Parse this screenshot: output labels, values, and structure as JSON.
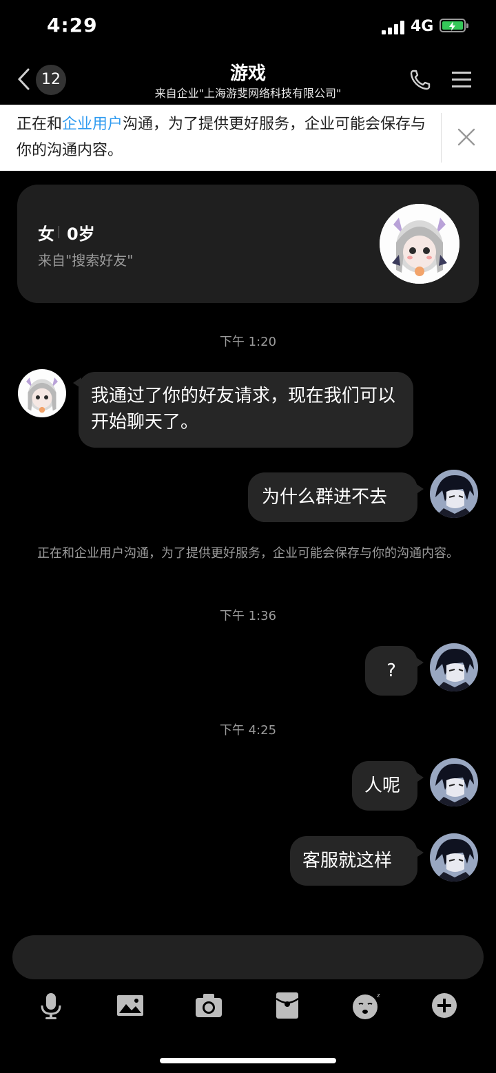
{
  "status_bar": {
    "time": "4:29",
    "network": "4G"
  },
  "nav": {
    "unread_count": "12",
    "title": "游戏",
    "subtitle": "来自企业\"上海游斐网络科技有限公司\""
  },
  "notice": {
    "prefix": "正在和",
    "link": "企业用户",
    "suffix": "沟通，为了提供更好服务，企业可能会保存与你的沟通内容。"
  },
  "profile": {
    "gender": "女",
    "age": "0岁",
    "source": "来自\"搜索好友\""
  },
  "chat": {
    "timestamps": [
      "下午 1:20",
      "下午 1:36",
      "下午 4:25"
    ],
    "system_message": "正在和企业用户沟通，为了提供更好服务，企业可能会保存与你的沟通内容。",
    "messages": [
      {
        "sender": "other",
        "text": "我通过了你的好友请求，现在我们可以开始聊天了。"
      },
      {
        "sender": "me",
        "text": "为什么群进不去"
      },
      {
        "sender": "me",
        "text": "?"
      },
      {
        "sender": "me",
        "text": "人呢"
      },
      {
        "sender": "me",
        "text": "客服就这样"
      }
    ]
  },
  "input": {
    "placeholder": ""
  },
  "toolbar": {
    "icons": [
      "microphone-icon",
      "image-icon",
      "camera-icon",
      "red-packet-icon",
      "emoji-icon",
      "plus-icon"
    ]
  },
  "colors": {
    "accent_link": "#2f9bf0",
    "bubble": "#262626",
    "background": "#000000",
    "battery": "#35c759"
  }
}
